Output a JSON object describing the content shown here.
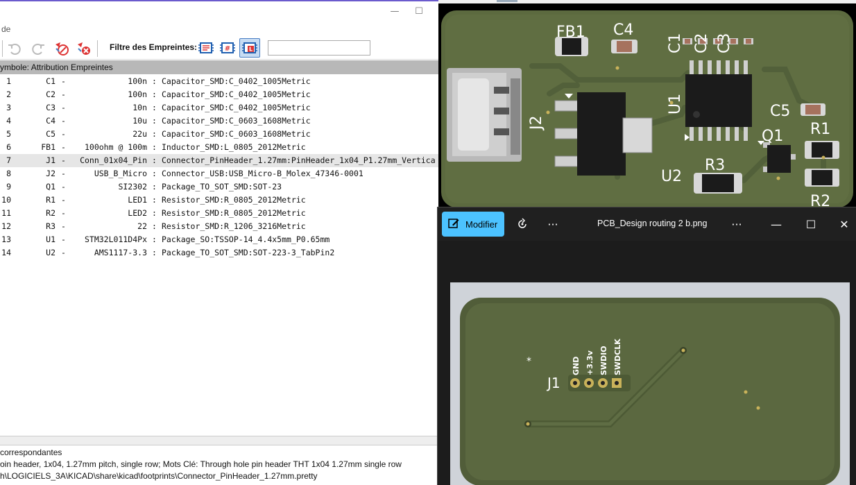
{
  "cvpcb": {
    "menu": "de",
    "filter_label": "Filtre des Empreintes:",
    "filter_input_value": "",
    "list_header": "ymbole: Attribution Empreintes",
    "rows": [
      {
        "num": "1",
        "ref": "C1",
        "value": "100n",
        "footprint": "Capacitor_SMD:C_0402_1005Metric"
      },
      {
        "num": "2",
        "ref": "C2",
        "value": "100n",
        "footprint": "Capacitor_SMD:C_0402_1005Metric"
      },
      {
        "num": "3",
        "ref": "C3",
        "value": "10n",
        "footprint": "Capacitor_SMD:C_0402_1005Metric"
      },
      {
        "num": "4",
        "ref": "C4",
        "value": "10u",
        "footprint": "Capacitor_SMD:C_0603_1608Metric"
      },
      {
        "num": "5",
        "ref": "C5",
        "value": "22u",
        "footprint": "Capacitor_SMD:C_0603_1608Metric"
      },
      {
        "num": "6",
        "ref": "FB1",
        "value": "100ohm @ 100m",
        "footprint": "Inductor_SMD:L_0805_2012Metric"
      },
      {
        "num": "7",
        "ref": "J1",
        "value": "Conn_01x04_Pin",
        "footprint": "Connector_PinHeader_1.27mm:PinHeader_1x04_P1.27mm_Vertica"
      },
      {
        "num": "8",
        "ref": "J2",
        "value": "USB_B_Micro",
        "footprint": "Connector_USB:USB_Micro-B_Molex_47346-0001"
      },
      {
        "num": "9",
        "ref": "Q1",
        "value": "SI2302",
        "footprint": "Package_TO_SOT_SMD:SOT-23"
      },
      {
        "num": "10",
        "ref": "R1",
        "value": "LED1",
        "footprint": "Resistor_SMD:R_0805_2012Metric"
      },
      {
        "num": "11",
        "ref": "R2",
        "value": "LED2",
        "footprint": "Resistor_SMD:R_0805_2012Metric"
      },
      {
        "num": "12",
        "ref": "R3",
        "value": "22",
        "footprint": "Resistor_SMD:R_1206_3216Metric"
      },
      {
        "num": "13",
        "ref": "U1",
        "value": "STM32L011D4Px",
        "footprint": "Package_SO:TSSOP-14_4.4x5mm_P0.65mm"
      },
      {
        "num": "14",
        "ref": "U2",
        "value": "AMS1117-3.3",
        "footprint": "Package_TO_SOT_SMD:SOT-223-3_TabPin2"
      }
    ],
    "selected_row": 7,
    "info": {
      "line1": " correspondantes",
      "line2": "oin header, 1x04, 1.27mm pitch, single row; Mots Clé: Through hole pin header THT 1x04 1.27mm single row",
      "line3": "h\\LOGICIELS_3A\\KICAD\\share\\kicad\\footprints\\Connector_PinHeader_1.27mm.pretty"
    }
  },
  "viewer3d": {
    "labels": {
      "fb1": "FB1",
      "c4": "C4",
      "c1": "C1",
      "c2": "C2",
      "c3": "C3",
      "j2": "J2",
      "u1": "U1",
      "c5": "C5",
      "q1": "Q1",
      "r1": "R1",
      "r3": "R3",
      "u2": "U2",
      "r2": "R2"
    }
  },
  "photos": {
    "edit_label": "Modifier",
    "file_title": "PCB_Design routing 2 b.png",
    "board_labels": {
      "j1": "J1",
      "gnd": "GND",
      "v33": "+3.3v",
      "swdio": "SWDIO",
      "swdclk": "SWDCLK",
      "star": "*"
    }
  }
}
